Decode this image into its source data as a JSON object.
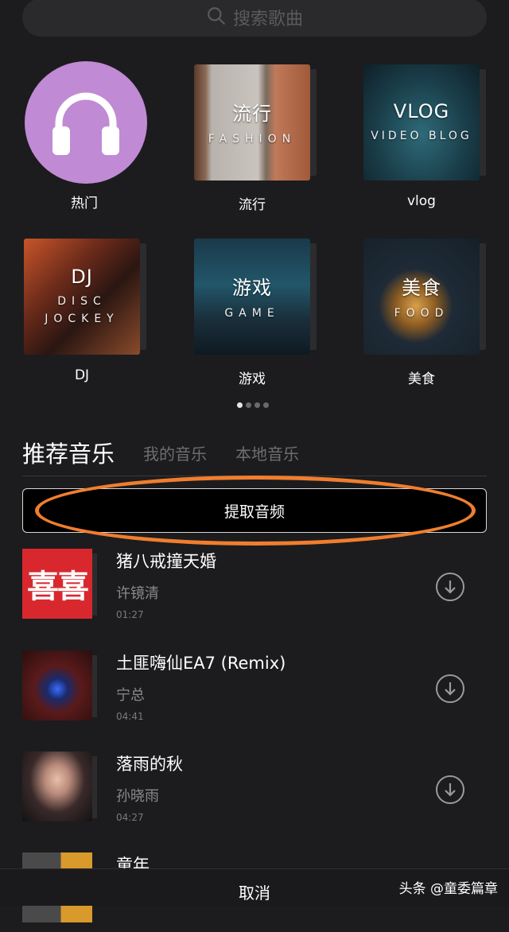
{
  "search": {
    "placeholder": "搜索歌曲"
  },
  "categories": [
    {
      "label": "热门"
    },
    {
      "label": "流行",
      "cover_title": "流行",
      "cover_sub": "FASHION"
    },
    {
      "label": "vlog",
      "cover_title": "VLOG",
      "cover_sub": "VIDEO BLOG"
    },
    {
      "label": "DJ",
      "cover_title": "DJ",
      "cover_sub": "DISC JOCKEY"
    },
    {
      "label": "游戏",
      "cover_title": "游戏",
      "cover_sub": "GAME"
    },
    {
      "label": "美食",
      "cover_title": "美食",
      "cover_sub": "FOOD"
    }
  ],
  "pager": {
    "pages": 4,
    "current": 1
  },
  "tabs": {
    "recommended": "推荐音乐",
    "mine": "我的音乐",
    "local": "本地音乐"
  },
  "extract_button": "提取音频",
  "songs": [
    {
      "title": "猪八戒撞天婚",
      "artist": "许镜清",
      "duration": "01:27",
      "cover_text": "喜喜"
    },
    {
      "title": "土匪嗨仙EA7 (Remix)",
      "artist": "宁总",
      "duration": "04:41"
    },
    {
      "title": "落雨的秋",
      "artist": "孙晓雨",
      "duration": "04:27"
    },
    {
      "title": "童年"
    }
  ],
  "bottom": {
    "cancel": "取消",
    "watermark": "头条 @童委篇章"
  },
  "colors": {
    "background": "#1c1c1e",
    "accent_circle": "#c08ad4",
    "highlight_ellipse": "#f07e2e",
    "cover_red": "#d9272e"
  }
}
